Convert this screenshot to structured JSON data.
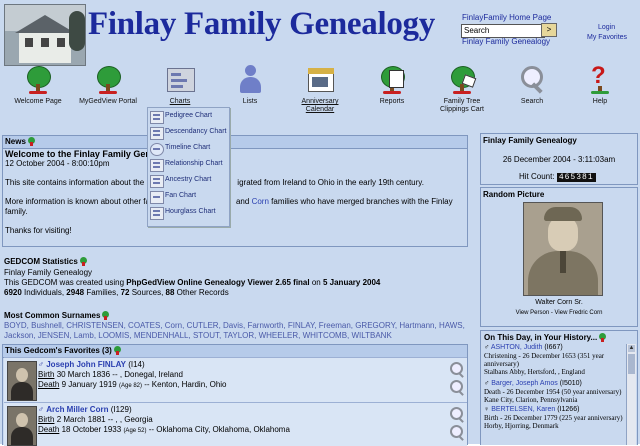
{
  "header": {
    "title": "Finlay Family Genealogy",
    "home_link": "FinlayFamily Home Page",
    "search_value": "Search",
    "search_go": ">",
    "subtitle": "Finlay Family Genealogy",
    "login": "Login",
    "favorites": "My Favorites"
  },
  "nav": [
    {
      "label": "Welcome Page",
      "icon": "tree-icon"
    },
    {
      "label": "MyGedView Portal",
      "icon": "tree-icon"
    },
    {
      "label": "Charts",
      "icon": "charts-icon"
    },
    {
      "label": "Lists",
      "icon": "person-icon"
    },
    {
      "label": "Anniversary Calendar",
      "icon": "calendar-icon"
    },
    {
      "label": "Reports",
      "icon": "reports-icon"
    },
    {
      "label": "Family Tree Clippings Cart",
      "icon": "clippings-icon"
    },
    {
      "label": "Search",
      "icon": "magnifier-icon"
    },
    {
      "label": "Help",
      "icon": "help-icon"
    }
  ],
  "charts_menu": [
    "Pedigree Chart",
    "Descendancy Chart",
    "Timeline Chart",
    "Relationship Chart",
    "Ancestry Chart",
    "Fan Chart",
    "Hourglass Chart"
  ],
  "news": {
    "heading": "News",
    "title": "Welcome to the Finlay Family Genealogy",
    "date": "12 October 2004 - 8:00:10pm",
    "para1_a": "This site contains information about the F",
    "para1_b": "igrated from Ireland to Ohio in the early 19th century.",
    "para2_a": "More information is known about other fa",
    "para2_link": "Corn",
    "para2_and": "and",
    "para2_b": "families who have merged branches with the Finlay",
    "para2_c": "family.",
    "thanks": "Thanks for visiting!"
  },
  "gedcom": {
    "heading": "GEDCOM Statistics",
    "name": "Finlay Family Genealogy",
    "created_pre": "This GEDCOM was created using",
    "created_software": "PhpGedView Online Genealogy Viewer 2.65 final",
    "created_on": "on",
    "created_date": "5 January 2004",
    "counts": [
      {
        "n": "6920",
        "label": "Individuals,"
      },
      {
        "n": "2948",
        "label": "Families,"
      },
      {
        "n": "72",
        "label": "Sources,"
      },
      {
        "n": "88",
        "label": "Other Records"
      }
    ],
    "surnames_heading": "Most Common Surnames",
    "surnames_line1": "BOYD, Bushnell, CHRISTENSEN, COATES, Corn, CUTLER, Davis, Farnworth, FINLAY, Freeman, GREGORY, Hartmann, HAWS,",
    "surnames_line2": "Jackson, JENSEN, Lamb, LOOMIS, MENDENHALL, STOUT, TAYLOR, WHEELER, WHITCOMB, WILTBANK"
  },
  "favorites": {
    "heading": "This Gedcom's Favorites (3)",
    "items": [
      {
        "name": "Joseph John FINLAY",
        "id": "(I14)",
        "birth_label": "Birth",
        "birth": "30 March 1836 -- , Donegal, Ireland",
        "death_label": "Death",
        "death_date": "9 January 1919",
        "death_age": "(Age 82)",
        "death_place": "-- Kenton, Hardin, Ohio"
      },
      {
        "name": "Arch Miller Corn",
        "id": "(I129)",
        "birth_label": "Birth",
        "birth": "2 March 1881 -- , , Georgia",
        "death_label": "Death",
        "death_date": "18 October 1933",
        "death_age": "(Age 52)",
        "death_place": "-- Oklahoma City, Oklahoma, Oklahoma"
      }
    ]
  },
  "sidebar": {
    "site_title": "Finlay Family Genealogy",
    "datetime": "26 December 2004 - 3:11:03am",
    "hit_label": "Hit Count:",
    "hit_count": "465381",
    "random_heading": "Random Picture",
    "picture_caption": "Walter Corn Sr.",
    "picture_links": "View Person - View Fredric Corn",
    "onthisday_heading": "On This Day, in Your History...",
    "events": [
      {
        "name": "ASHTON, Judith",
        "id": "(I667)",
        "line1": "Christening - 26 December 1653 (351 year",
        "line2": "anniversary)",
        "line3": "Stalbans Abby, Hertsford, , England"
      },
      {
        "name": "Barger, Joseph Amos",
        "id": "(I5010)",
        "line1": "Death - 26 December 1954 (50 year anniversary)",
        "line2": "Kane City, Clarion, Pennsylvania",
        "line3": ""
      },
      {
        "name": "BERTELSEN, Karen",
        "id": "(I1266)",
        "line1": "Birth - 26 December 1779 (225 year anniversary)",
        "line2": "Horby, Hjorring, Denmark",
        "line3": ""
      }
    ]
  },
  "colors": {
    "background": "#c9d9ef",
    "title": "#1c2a9c",
    "link": "#2a3fb0",
    "panel_border": "#7f97bf"
  }
}
